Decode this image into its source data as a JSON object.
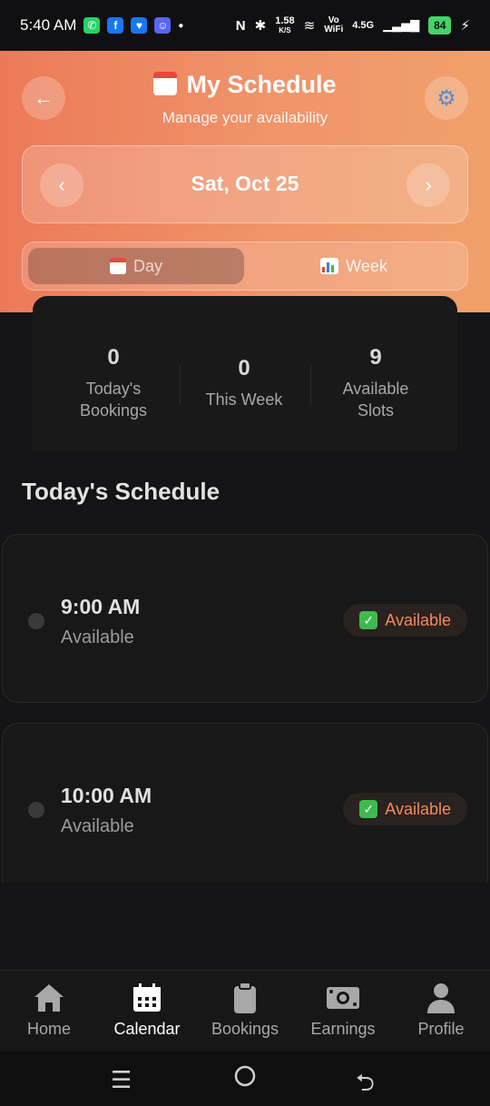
{
  "status_bar": {
    "time": "5:40 AM",
    "app_icons": [
      "whatsapp-icon",
      "facebook-icon",
      "messenger-icon",
      "discord-icon"
    ],
    "net_speed_value": "1.58",
    "net_speed_unit": "K/S",
    "vowifi_line1": "Vo",
    "vowifi_line2": "WiFi",
    "network": "4.5G",
    "battery": "84"
  },
  "header": {
    "title": "My Schedule",
    "subtitle": "Manage your availability",
    "date": "Sat, Oct 25",
    "view_toggle": [
      {
        "label": "Day",
        "active": true
      },
      {
        "label": "Week",
        "active": false
      }
    ]
  },
  "stats": [
    {
      "value": "0",
      "label": "Today's Bookings"
    },
    {
      "value": "0",
      "label": "This Week"
    },
    {
      "value": "9",
      "label": "Available Slots"
    }
  ],
  "schedule": {
    "title": "Today's Schedule",
    "slots": [
      {
        "time": "9:00 AM",
        "status_text": "Available",
        "badge": "Available"
      },
      {
        "time": "10:00 AM",
        "status_text": "Available",
        "badge": "Available"
      }
    ]
  },
  "tabbar": {
    "items": [
      {
        "label": "Home",
        "active": false
      },
      {
        "label": "Calendar",
        "active": true
      },
      {
        "label": "Bookings",
        "active": false
      },
      {
        "label": "Earnings",
        "active": false
      },
      {
        "label": "Profile",
        "active": false
      }
    ]
  },
  "colors": {
    "accent": "#f08a5d",
    "header_gradient_start": "#ec7a58",
    "header_gradient_end": "#f1a06b",
    "background": "#141416"
  }
}
